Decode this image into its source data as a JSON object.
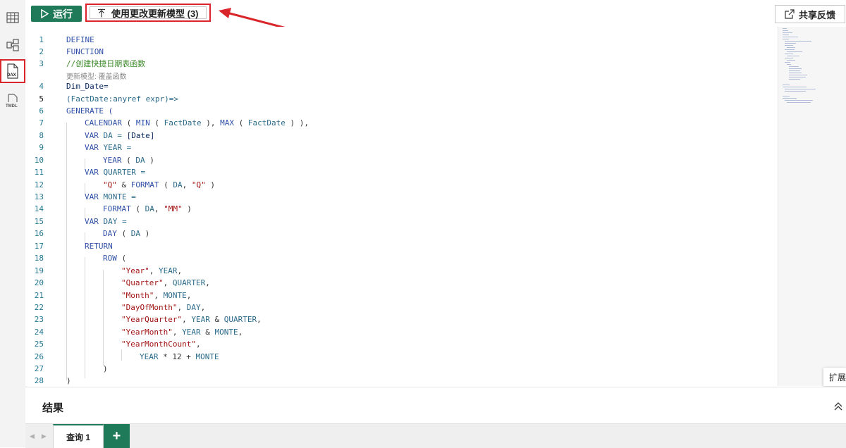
{
  "rail": {
    "items": [
      {
        "icon": "table-view-icon"
      },
      {
        "icon": "model-view-icon"
      },
      {
        "icon": "dax-query-view-icon",
        "label": "DAX"
      },
      {
        "icon": "tmdl-view-icon",
        "label": "TMDL"
      }
    ]
  },
  "toolbar": {
    "run_label": "运行",
    "update_label": "使用更改更新模型 (3)",
    "share_label": "共享反馈"
  },
  "editor": {
    "lens_text": "更新模型: 覆盖函数",
    "lines": [
      {
        "n": "1"
      },
      {
        "n": "2"
      },
      {
        "n": "3"
      },
      {
        "n": "4"
      },
      {
        "n": "5"
      },
      {
        "n": "6"
      },
      {
        "n": "7"
      },
      {
        "n": "8"
      },
      {
        "n": "9"
      },
      {
        "n": "10"
      },
      {
        "n": "11"
      },
      {
        "n": "12"
      },
      {
        "n": "13"
      },
      {
        "n": "14"
      },
      {
        "n": "15"
      },
      {
        "n": "16"
      },
      {
        "n": "17"
      },
      {
        "n": "18"
      },
      {
        "n": "19"
      },
      {
        "n": "20"
      },
      {
        "n": "21"
      },
      {
        "n": "22"
      },
      {
        "n": "23"
      },
      {
        "n": "24"
      },
      {
        "n": "25"
      },
      {
        "n": "26"
      },
      {
        "n": "27"
      },
      {
        "n": "28"
      }
    ],
    "code": {
      "l1": "DEFINE",
      "l2": "FUNCTION",
      "l3": "//创建快捷日期表函数",
      "l4": "Dim_Date=",
      "l5": "(FactDate:anyref expr)=>",
      "l6": "GENERATE (",
      "l7a": "CALENDAR",
      "l7b": " ( ",
      "l7c": "MIN",
      "l7d": " ( ",
      "l7e": "FactDate",
      "l7f": " ), ",
      "l7g": "MAX",
      "l7h": " ( ",
      "l7i": "FactDate",
      "l7j": " ) ),",
      "l8a": "VAR",
      "l8b": " DA = ",
      "l8c": "[Date]",
      "l9a": "VAR",
      "l9b": " YEAR =",
      "l10a": "YEAR",
      "l10b": " ( ",
      "l10c": "DA",
      "l10d": " )",
      "l11a": "VAR",
      "l11b": " QUARTER =",
      "l12a": "\"Q\"",
      "l12b": " & ",
      "l12c": "FORMAT",
      "l12d": " ( ",
      "l12e": "DA",
      "l12f": ", ",
      "l12g": "\"Q\"",
      "l12h": " )",
      "l13a": "VAR",
      "l13b": " MONTE =",
      "l14a": "FORMAT",
      "l14b": " ( ",
      "l14c": "DA",
      "l14d": ", ",
      "l14e": "\"MM\"",
      "l14f": " )",
      "l15a": "VAR",
      "l15b": " DAY =",
      "l16a": "DAY",
      "l16b": " ( ",
      "l16c": "DA",
      "l16d": " )",
      "l17": "RETURN",
      "l18a": "ROW",
      "l18b": " (",
      "l19a": "\"Year\"",
      "l19b": ", ",
      "l19c": "YEAR",
      "l19d": ",",
      "l20a": "\"Quarter\"",
      "l20b": ", ",
      "l20c": "QUARTER",
      "l20d": ",",
      "l21a": "\"Month\"",
      "l21b": ", ",
      "l21c": "MONTE",
      "l21d": ",",
      "l22a": "\"DayOfMonth\"",
      "l22b": ", ",
      "l22c": "DAY",
      "l22d": ",",
      "l23a": "\"YearQuarter\"",
      "l23b": ", ",
      "l23c": "YEAR",
      "l23d": " & ",
      "l23e": "QUARTER",
      "l23f": ",",
      "l24a": "\"YearMonth\"",
      "l24b": ", ",
      "l24c": "YEAR",
      "l24d": " & ",
      "l24e": "MONTE",
      "l24f": ",",
      "l25a": "\"YearMonthCount\"",
      "l25b": ",",
      "l26a": "YEAR",
      "l26b": " * ",
      "l26c": "12",
      "l26d": " + ",
      "l26e": "MONTE",
      "l27": ")",
      "l28": ")"
    }
  },
  "tooltip": {
    "text": "扩展"
  },
  "results": {
    "title": "结果"
  },
  "tabs": {
    "query_label": "查询 1",
    "add_label": "+"
  },
  "colors": {
    "accent": "#1f7a5a",
    "highlight": "#d9262a"
  }
}
